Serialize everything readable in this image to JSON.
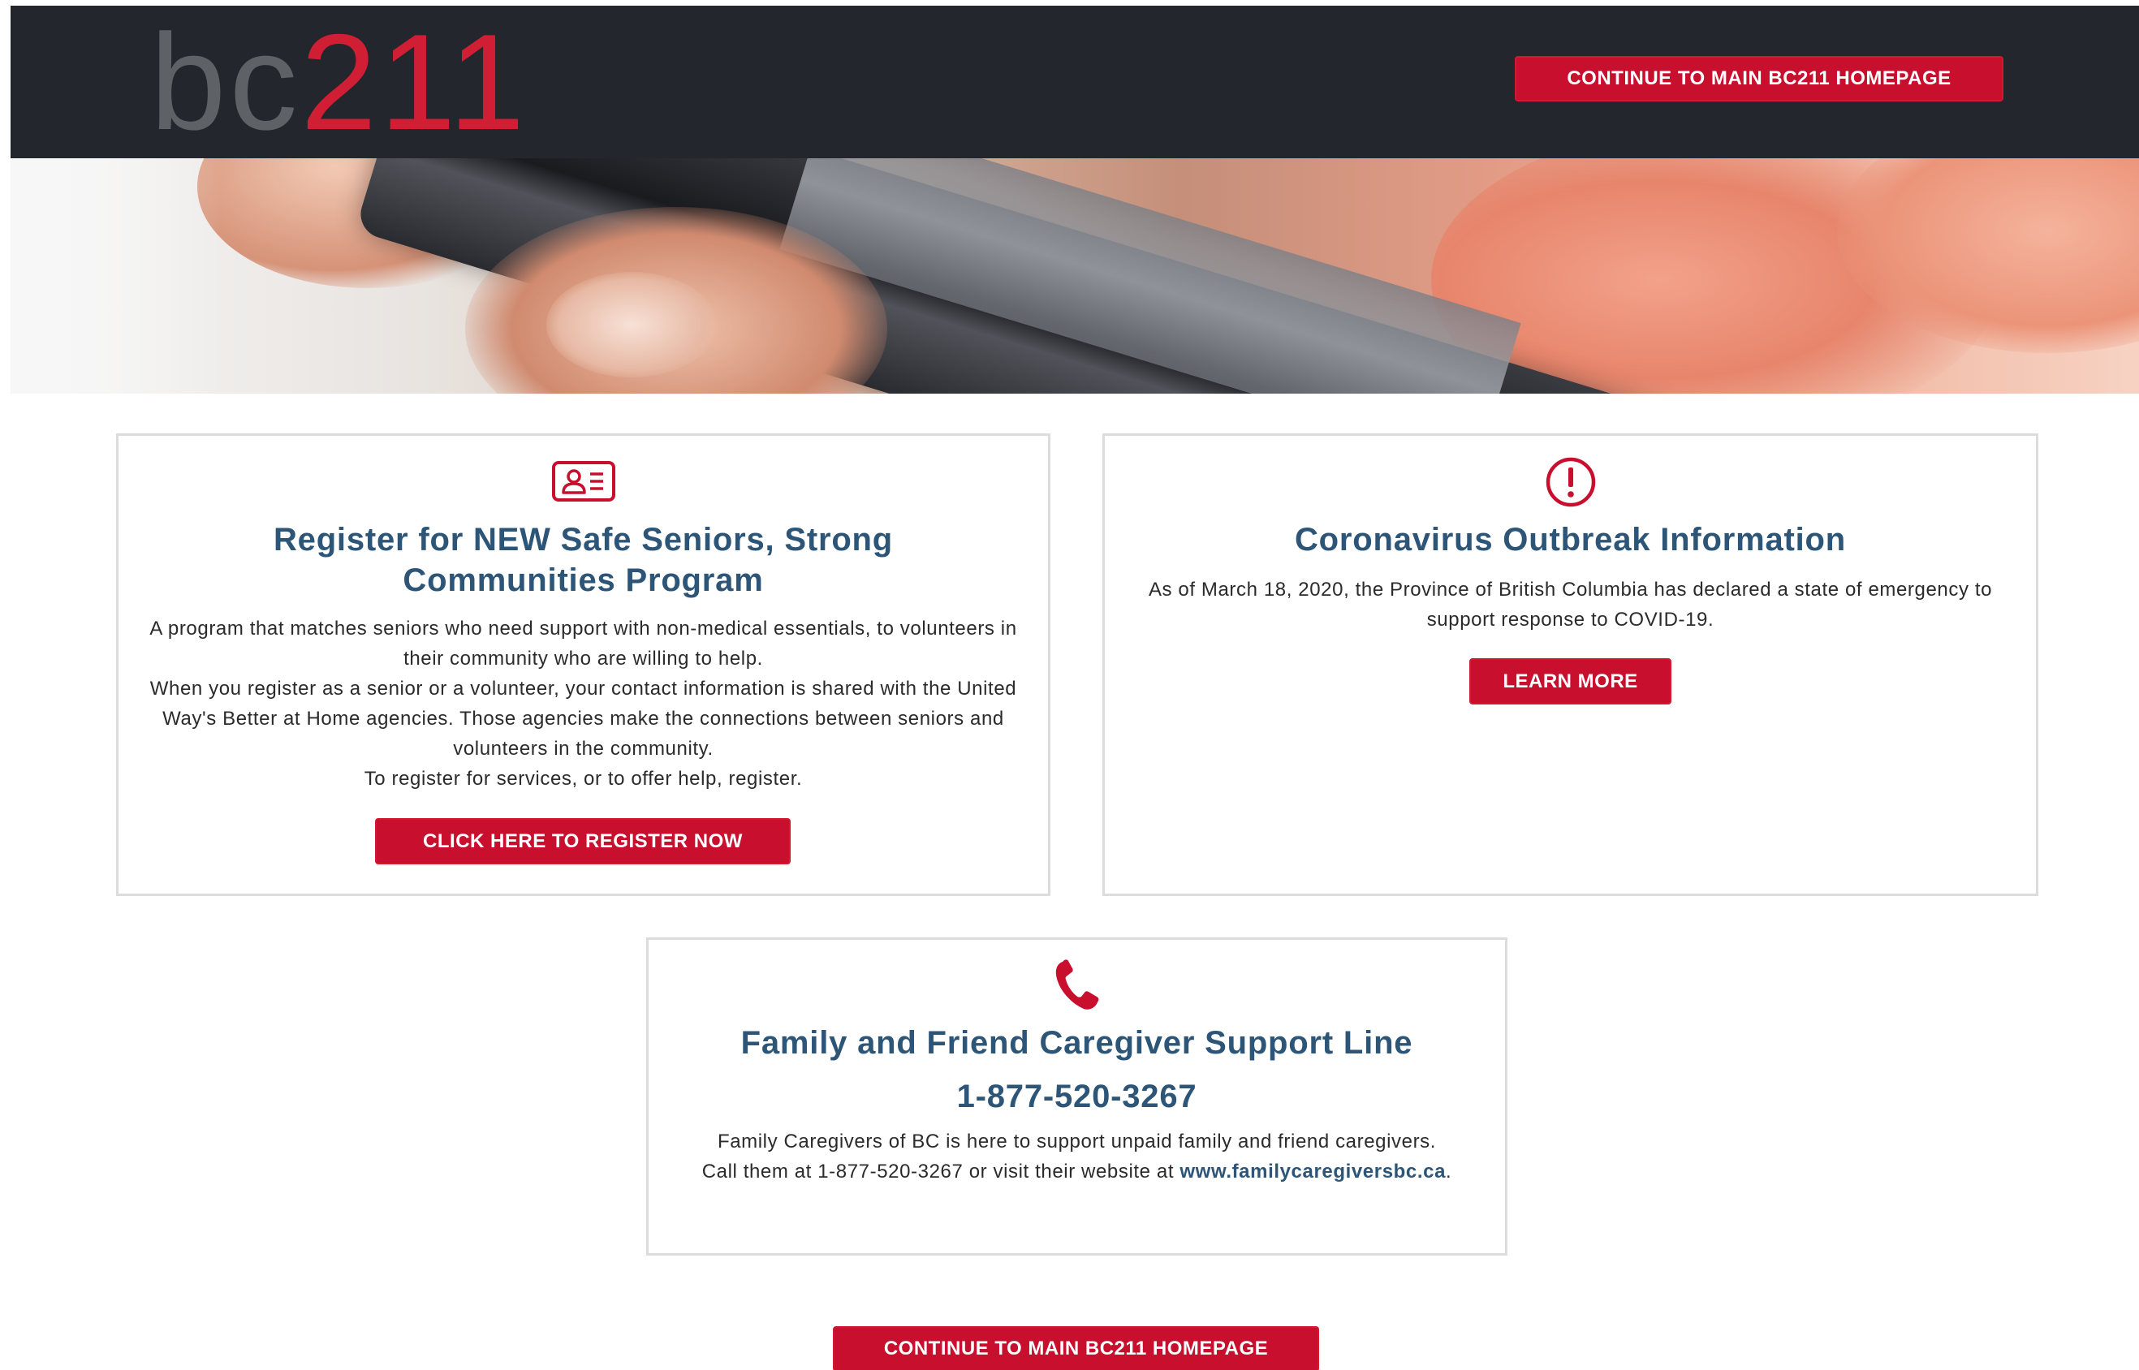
{
  "header": {
    "logo_prefix": "bc",
    "logo_number": "211",
    "continue_button": "CONTINUE TO MAIN BC211 HOMEPAGE"
  },
  "hero": {
    "image_description_icon": "hand-holding-phone-photo"
  },
  "cards": {
    "seniors": {
      "icon": "id-card-icon",
      "title": "Register for NEW Safe Seniors, Strong Communities Program",
      "paragraph1": "A program that matches seniors who need support with non-medical essentials, to volunteers in their community who are willing to help.",
      "paragraph2": "When you register as a senior or a volunteer, your contact information is shared with the United Way's Better at Home agencies. Those agencies make the connections between seniors and volunteers in the community.",
      "paragraph3": "To register for services, or to offer help, register.",
      "button": "CLICK HERE TO REGISTER NOW"
    },
    "coronavirus": {
      "icon": "exclamation-circle-icon",
      "title": "Coronavirus Outbreak Information",
      "body": "As of March 18, 2020, the Province of British Columbia has declared a state of emergency to support response to COVID-19.",
      "button": "LEARN MORE"
    },
    "caregiver": {
      "icon": "phone-icon",
      "title": "Family and Friend Caregiver Support Line",
      "phone": "1-877-520-3267",
      "body": "Family Caregivers of BC is here to support unpaid family and friend caregivers. Call them at 1-877-520-3267 or visit their website at",
      "website": "www.familycaregiversbc.ca",
      "trailing": "."
    }
  },
  "footer": {
    "continue_button": "CONTINUE TO MAIN BC211 HOMEPAGE"
  },
  "colors": {
    "header_bg": "#23272d",
    "brand_red": "#c8102e",
    "title_blue": "#2c5577",
    "logo_gray": "#5e6266"
  }
}
